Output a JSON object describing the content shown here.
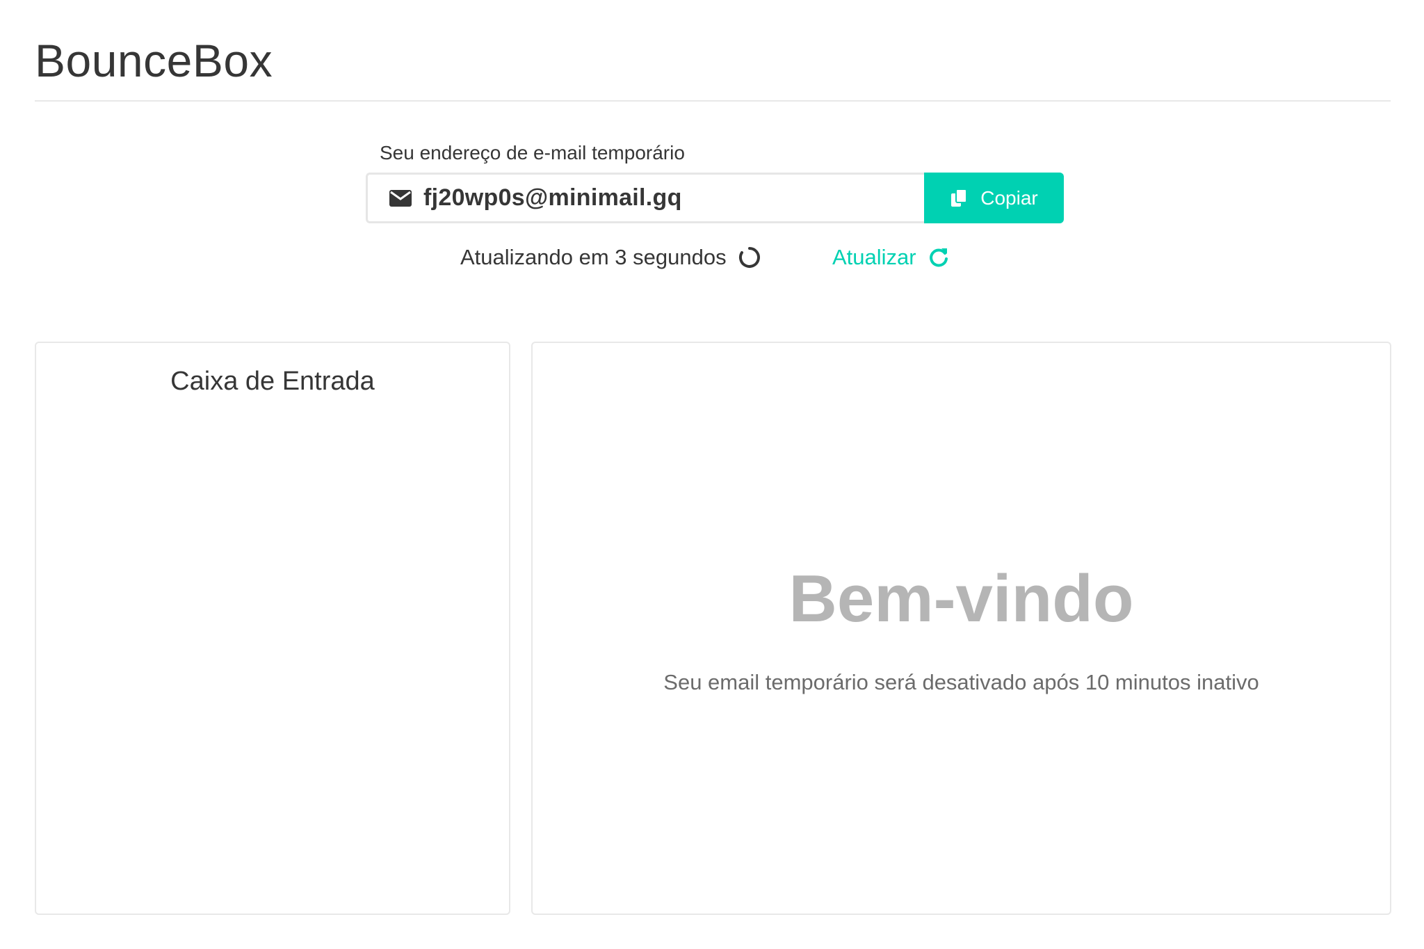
{
  "app": {
    "title": "BounceBox"
  },
  "email": {
    "label": "Seu endereço de e-mail temporário",
    "address": "fj20wp0s@minimail.gq",
    "copy_label": "Copiar"
  },
  "refresh": {
    "status_text": "Atualizando em 3 segundos",
    "link_label": "Atualizar"
  },
  "inbox": {
    "title": "Caixa de Entrada",
    "messages": []
  },
  "viewer": {
    "welcome_title": "Bem-vindo",
    "welcome_subtitle": "Seu email temporário será desativado após 10 minutos inativo"
  },
  "icons": {
    "mail": "envelope-icon",
    "copy": "copy-icon",
    "spinner": "spinner-icon",
    "refresh": "redo-icon"
  },
  "colors": {
    "accent": "#00d1b2",
    "text": "#363636",
    "muted": "#b5b5b5",
    "border": "#e8e8e8"
  }
}
